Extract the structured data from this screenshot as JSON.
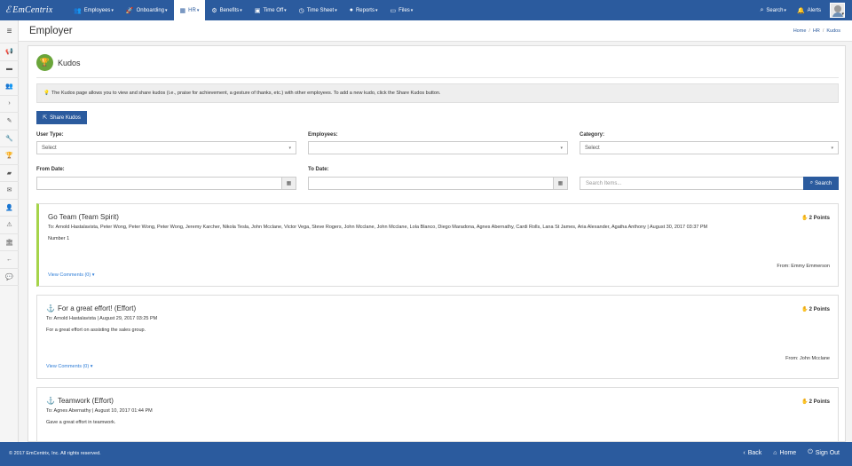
{
  "app": {
    "brand": "EmCentrix",
    "page_title": "Employer"
  },
  "nav": {
    "items": [
      {
        "label": "Employees",
        "icon": "users-icon"
      },
      {
        "label": "Onboarding",
        "icon": "rocket-icon"
      },
      {
        "label": "HR",
        "icon": "building-icon"
      },
      {
        "label": "Benefits",
        "icon": "cog-icon"
      },
      {
        "label": "Time Off",
        "icon": "calendar-icon"
      },
      {
        "label": "Time Sheet",
        "icon": "clock-icon"
      },
      {
        "label": "Reports",
        "icon": "globe-icon"
      },
      {
        "label": "Files",
        "icon": "folder-icon"
      }
    ],
    "search_label": "Search",
    "alerts_label": "Alerts"
  },
  "breadcrumb": {
    "home": "Home",
    "hr": "HR",
    "current": "Kudos"
  },
  "kudos": {
    "title": "Kudos",
    "info": "The Kudos page allows you to view and share kudos (i.e., praise for achievement, a gesture of thanks, etc.) with other employees. To add a new kudo, click the Share Kudos button.",
    "share_button": "Share Kudos"
  },
  "filters": {
    "user_type": {
      "label": "User Type:",
      "value": "Select"
    },
    "employees": {
      "label": "Employees:",
      "value": ""
    },
    "category": {
      "label": "Category:",
      "value": "Select"
    },
    "from_date": {
      "label": "From Date:"
    },
    "to_date": {
      "label": "To Date:"
    },
    "search": {
      "placeholder": "Search Items...",
      "button": "Search"
    }
  },
  "cards": [
    {
      "title": "Go Team (Team Spirit)",
      "points": "2 Points",
      "to": "To: Arnold Hastalavista, Peter Wong, Peter Wong, Peter Wong, Jeremy Karcher, Nikola Tesla, John Mcclane, Victor Vega, Steve Rogers, John Mcclane, John Mcclane, Lola Blanco, Diego Maradona, Agnes Abernathy, Cardi Rolls, Lana St James, Aria Alexander, Agatha Anthony | August 30, 2017 03:37 PM",
      "message": "Number 1",
      "comments": "View Comments (0)",
      "from": "From: Emmy Emmerson"
    },
    {
      "title": "For a great effort! (Effort)",
      "points": "2 Points",
      "to": "To: Arnold Hastalavista | August 29, 2017 03:25 PM",
      "message": "For a great effort on assisting the sales group.",
      "comments": "View Comments (0)",
      "from": "From: John Mcclane"
    },
    {
      "title": "Teamwork (Effort)",
      "points": "2 Points",
      "to": "To: Agnes Abernathy | August 10, 2017 01:44 PM",
      "message": "Gave a great effort in teamwork."
    }
  ],
  "footer": {
    "copyright": "© 2017 EmCentrix, Inc. All rights reserved.",
    "back": "Back",
    "home": "Home",
    "sign_out": "Sign Out"
  },
  "colors": {
    "primary": "#2b5b9e",
    "accent_green": "#a6d44a",
    "trophy_green": "#6aa53a",
    "link": "#2b7bd6"
  }
}
